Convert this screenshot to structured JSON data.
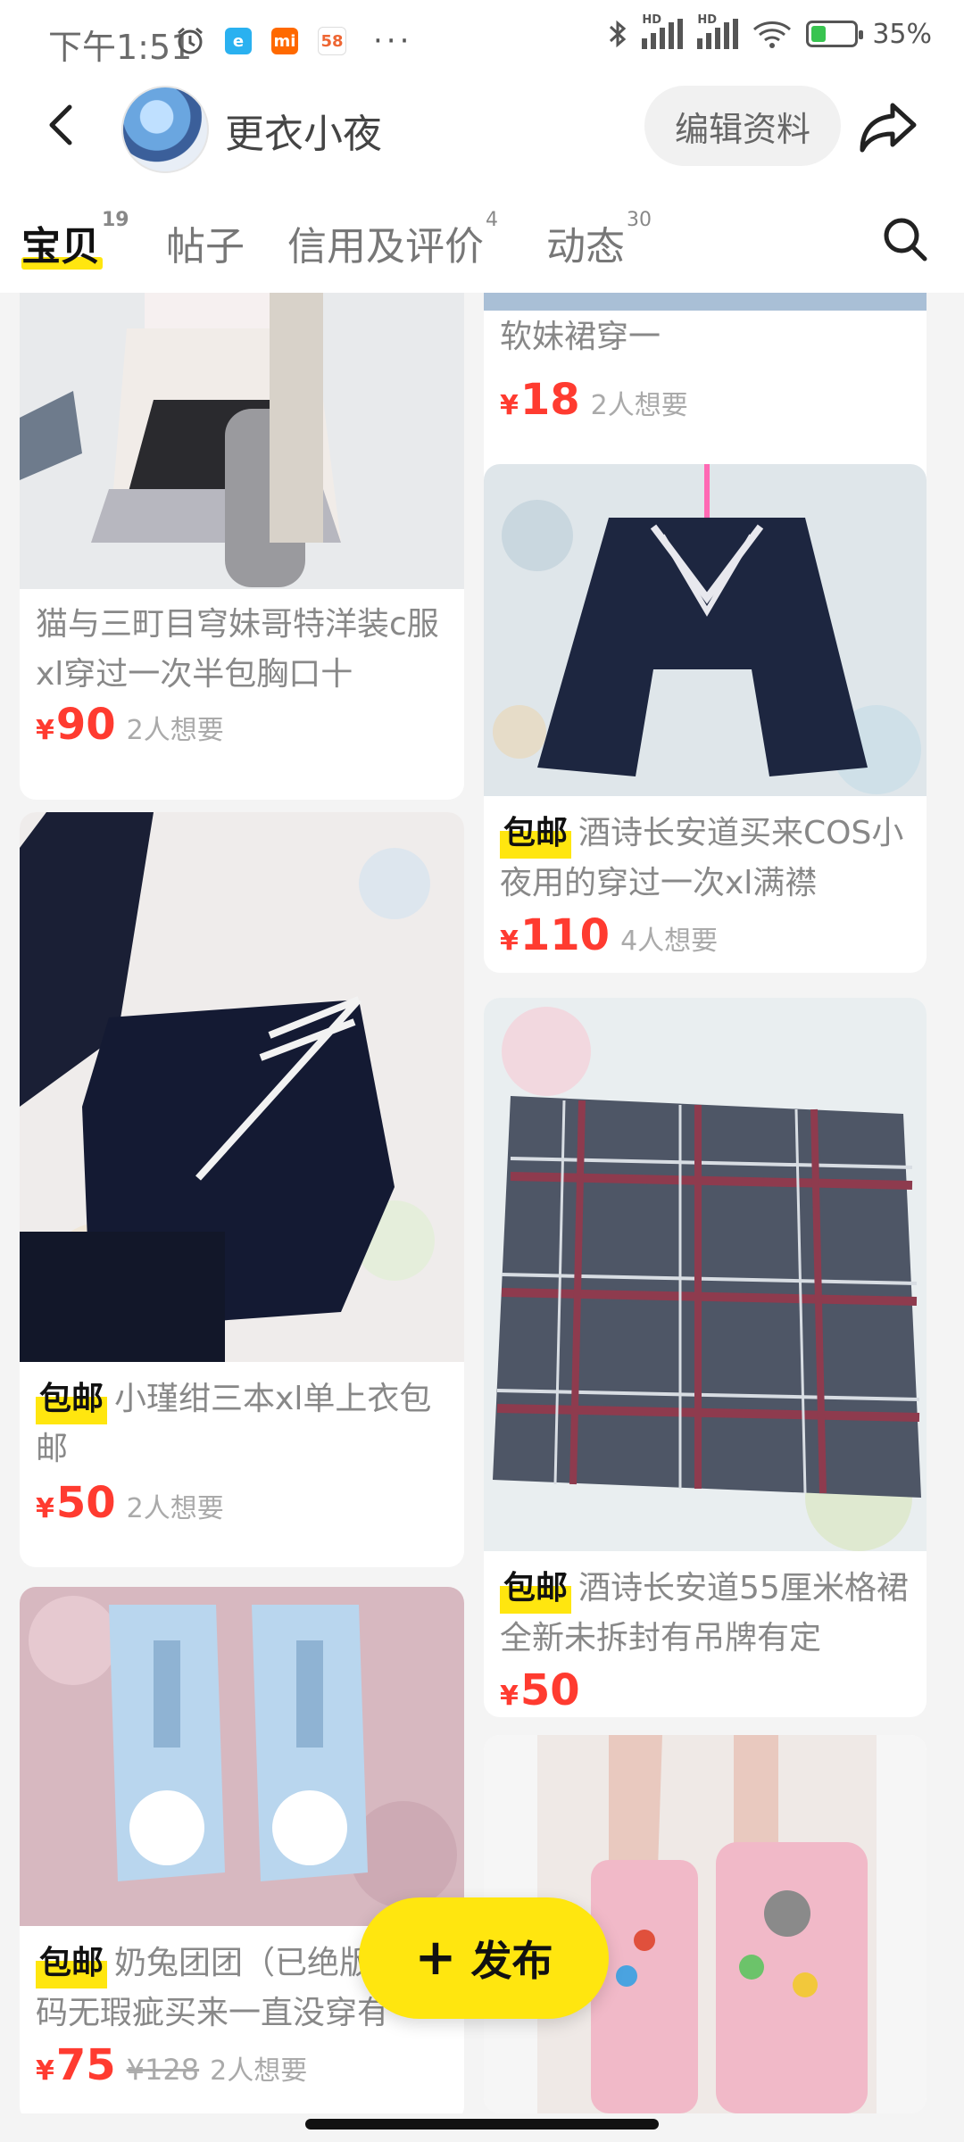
{
  "status_bar": {
    "time": "下午1:51",
    "app_icons": [
      "alarm-icon",
      "browser-icon",
      "mi-icon",
      "58-icon"
    ],
    "more": "···",
    "battery": "35%",
    "battery_level": 0.35
  },
  "header": {
    "shop_name": "更衣小夜",
    "edit_profile": "编辑资料"
  },
  "tabs": [
    {
      "label": "宝贝",
      "count": "19",
      "active": true
    },
    {
      "label": "帖子",
      "count": "",
      "active": false
    },
    {
      "label": "信用及评价",
      "count": "4",
      "active": false
    },
    {
      "label": "动态",
      "count": "30",
      "active": false
    }
  ],
  "badge_text": "包邮",
  "items": [
    {
      "title": "猫与三町目穹妹哥特洋装c服xl穿过一次半包胸口十",
      "price": "90",
      "wants": "2人想要",
      "free_ship": false
    },
    {
      "title": "小瑾绀三本xl单上衣包邮",
      "price": "50",
      "wants": "2人想要",
      "free_ship": true
    },
    {
      "title": "奶兔团团（已绝版）4码无瑕疵买来一直没穿有",
      "price": "75",
      "original_price": "¥128",
      "wants": "2人想要",
      "free_ship": true
    },
    {
      "title": "软妹裙穿一",
      "price": "18",
      "wants": "2人想要",
      "free_ship": false
    },
    {
      "title": "酒诗长安道买来COS小夜用的穿过一次xl满襟",
      "price": "110",
      "wants": "4人想要",
      "free_ship": true
    },
    {
      "title": "酒诗长安道55厘米格裙全新未拆封有吊牌有定",
      "price": "50",
      "wants": "",
      "free_ship": true
    },
    {
      "title": "",
      "price": "",
      "wants": "",
      "free_ship": false
    }
  ],
  "currency": "¥",
  "publish_button": "发布",
  "colors": {
    "accent_yellow": "#ffe60f",
    "price_red": "#ff3b30"
  }
}
